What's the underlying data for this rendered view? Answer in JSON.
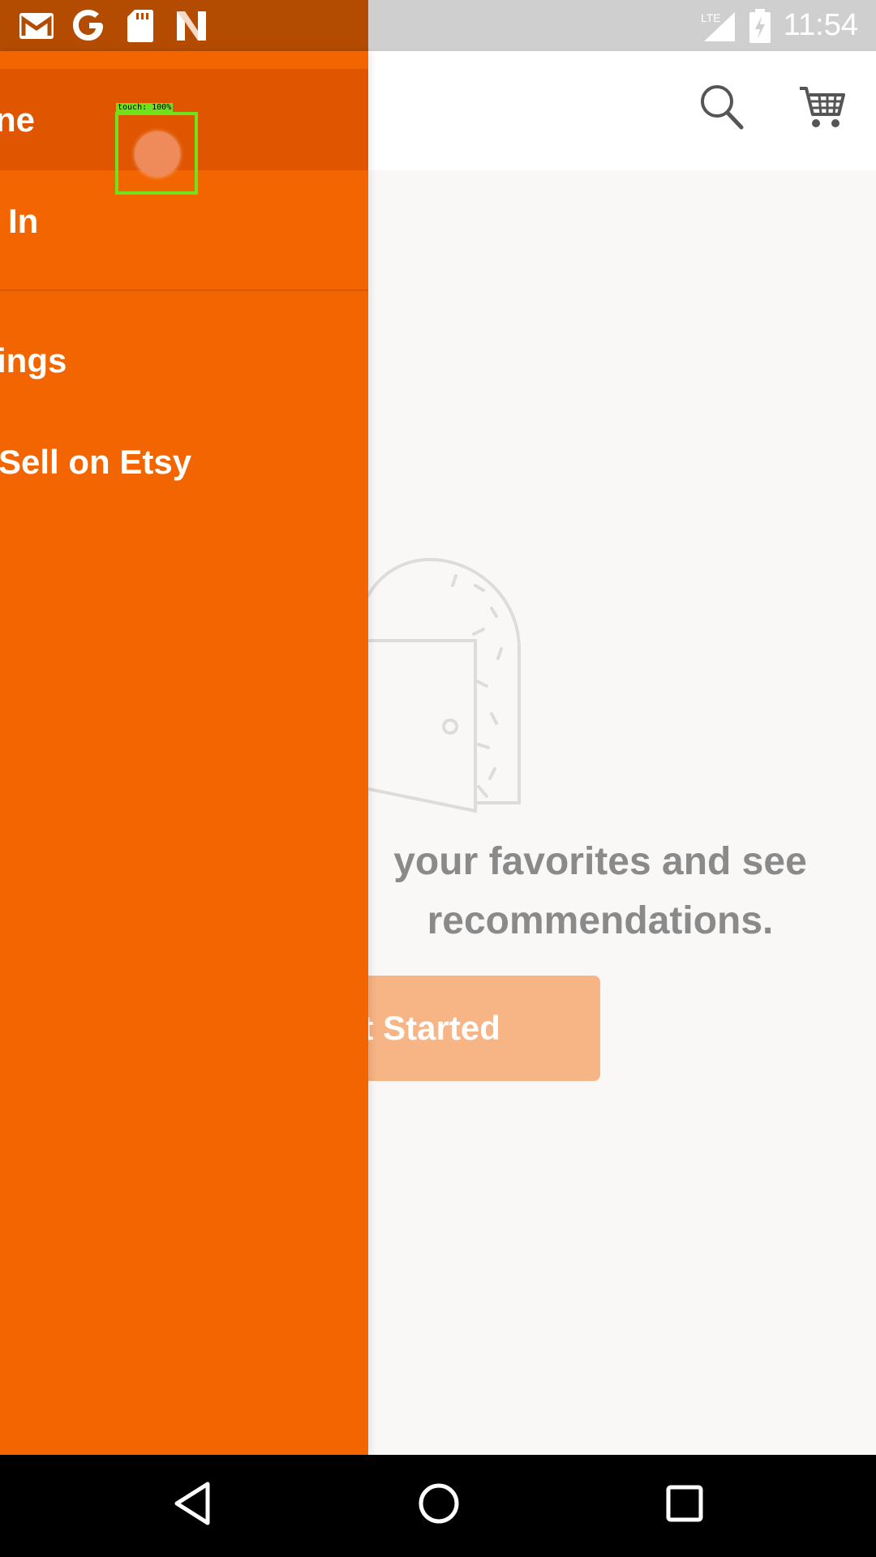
{
  "status_bar": {
    "time": "11:54",
    "network": "LTE",
    "left_icons": [
      "gmail-icon",
      "google-icon",
      "sd-card-icon",
      "n-icon"
    ]
  },
  "app_bar": {
    "actions": [
      "search-icon",
      "cart-icon"
    ]
  },
  "drawer": {
    "items": [
      {
        "label": "ne"
      },
      {
        "label": "In"
      },
      {
        "label": "ings"
      },
      {
        "label": "Sell on Etsy"
      }
    ],
    "accent_color": "#f26500"
  },
  "main": {
    "message": "your favorites and see\nrecommendations.",
    "cta_label": "et Started"
  },
  "touch_overlay": {
    "label": "touch: 100%"
  },
  "nav_bar": {
    "buttons": [
      "back-icon",
      "home-icon",
      "recents-icon"
    ]
  }
}
